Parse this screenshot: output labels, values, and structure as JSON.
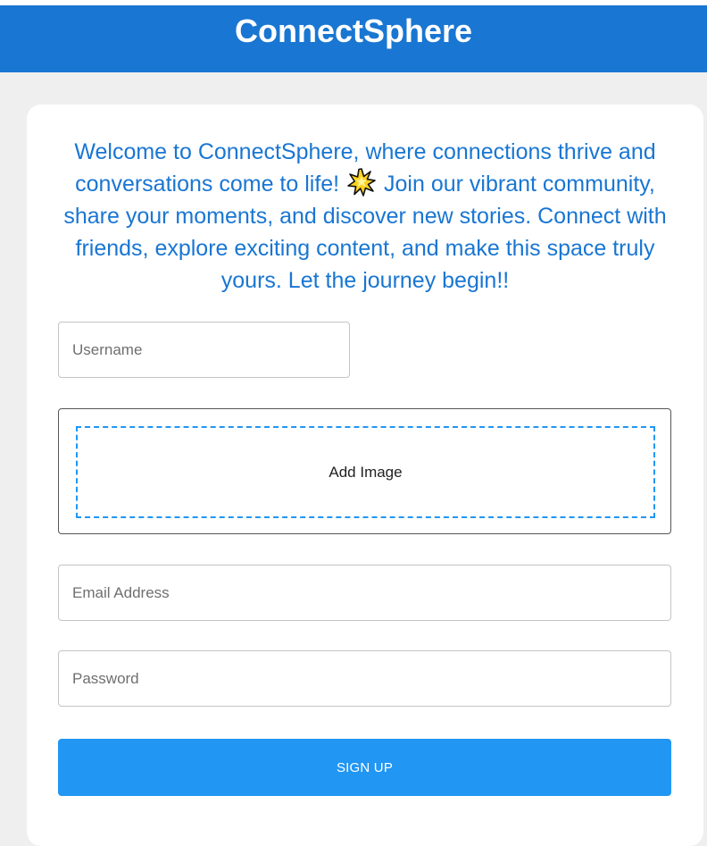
{
  "app": {
    "title": "ConnectSphere"
  },
  "welcome": {
    "part1": "Welcome to ConnectSphere, where connections thrive and conversations come to life!",
    "icon": "sparkle-icon",
    "part2": "Join our vibrant community, share your moments, and discover new stories. Connect with friends, explore exciting content, and make this space truly yours. Let the journey begin!!"
  },
  "form": {
    "username_placeholder": "Username",
    "image_label": "Add Image",
    "email_placeholder": "Email Address",
    "password_placeholder": "Password",
    "submit_label": "SIGN UP"
  },
  "colors": {
    "header_bg": "#1976d2",
    "accent": "#2196f3",
    "page_bg": "#efefef",
    "welcome_text": "#1976d2"
  }
}
